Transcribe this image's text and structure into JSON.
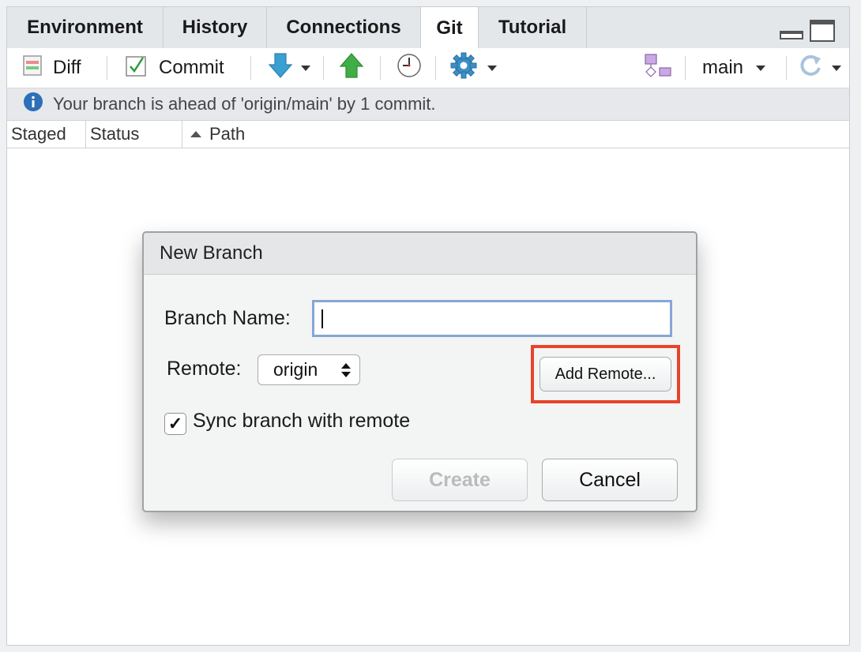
{
  "tabs": [
    {
      "label": "Environment",
      "active": false
    },
    {
      "label": "History",
      "active": false
    },
    {
      "label": "Connections",
      "active": false
    },
    {
      "label": "Git",
      "active": true
    },
    {
      "label": "Tutorial",
      "active": false
    }
  ],
  "toolbar": {
    "diff_label": "Diff",
    "commit_label": "Commit",
    "branch_label": "main"
  },
  "info": {
    "message": "Your branch is ahead of 'origin/main' by 1 commit."
  },
  "columns": {
    "staged": "Staged",
    "status": "Status",
    "path": "Path"
  },
  "dialog": {
    "title": "New Branch",
    "branch_name_label": "Branch Name:",
    "branch_name_value": "",
    "remote_label": "Remote:",
    "remote_value": "origin",
    "add_remote_label": "Add Remote...",
    "sync_label": "Sync branch with remote",
    "sync_checked": true,
    "create_label": "Create",
    "cancel_label": "Cancel"
  },
  "colors": {
    "highlight": "#e8432b",
    "input_focus": "#86a6d6",
    "info_icon": "#2d6fb8",
    "pull_arrow": "#3a9fd1",
    "push_arrow": "#3fae45"
  }
}
